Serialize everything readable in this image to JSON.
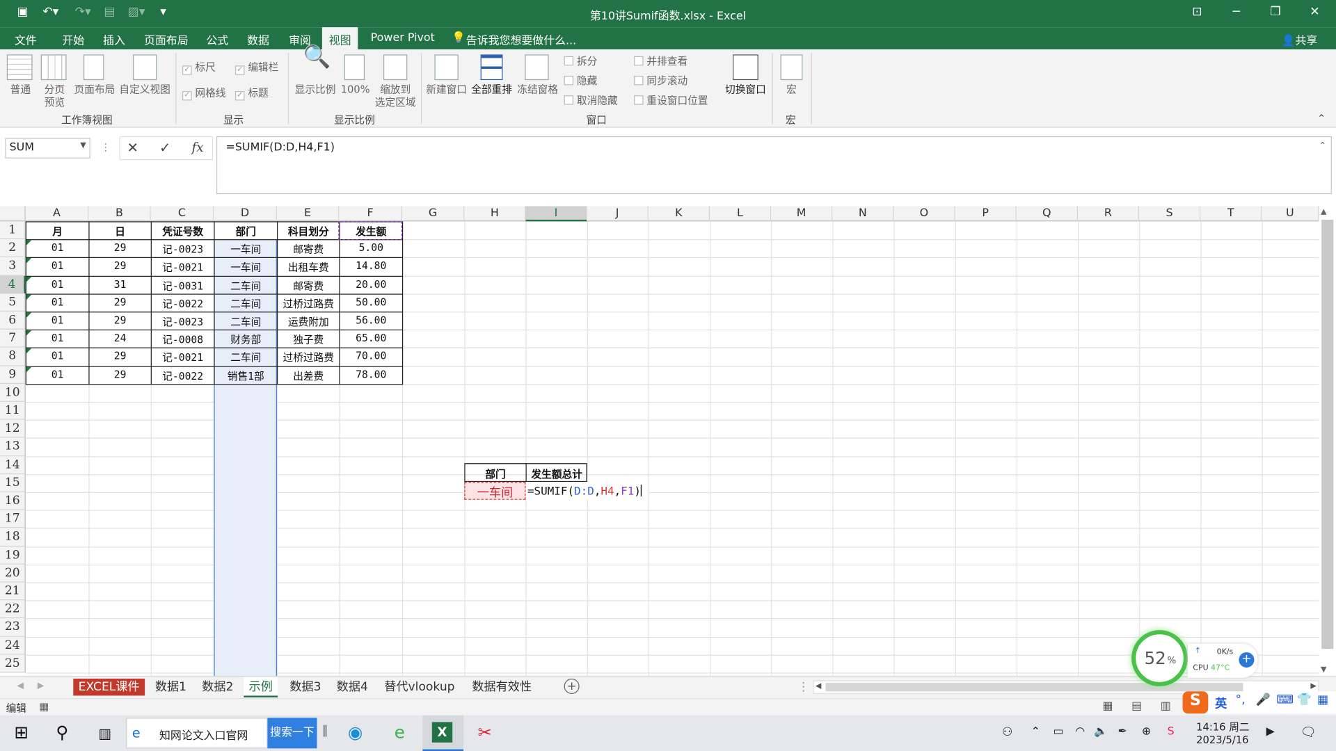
{
  "app": {
    "title": "第10讲Sumif函数.xlsx - Excel"
  },
  "menu": [
    "文件",
    "开始",
    "插入",
    "页面布局",
    "公式",
    "数据",
    "审阅",
    "视图",
    "Power Pivot"
  ],
  "menu_active": "视图",
  "tell_me": "告诉我您想要做什么...",
  "share": "共享",
  "ribbon": {
    "workbook_views": {
      "normal": "普通",
      "page_break_1": "分页",
      "page_break_2": "预览",
      "page_layout": "页面布局",
      "custom": "自定义视图",
      "group": "工作簿视图"
    },
    "show": {
      "ruler": "标尺",
      "formula_bar": "编辑栏",
      "gridlines": "网格线",
      "headings": "标题",
      "group": "显示"
    },
    "zoom": {
      "zoom": "显示比例",
      "hundred": "100%",
      "zoom_sel_1": "缩放到",
      "zoom_sel_2": "选定区域",
      "group": "显示比例"
    },
    "window": {
      "new_window": "新建窗口",
      "arrange_all": "全部重排",
      "freeze": "冻结窗格",
      "split": "拆分",
      "hide": "隐藏",
      "unhide": "取消隐藏",
      "side_by_side": "并排查看",
      "sync_scroll": "同步滚动",
      "reset_pos": "重设窗口位置",
      "switch": "切换窗口",
      "group": "窗口"
    },
    "macros": {
      "macro": "宏",
      "group": "宏"
    }
  },
  "formula_bar": {
    "name_box": "SUM",
    "formula": "=SUMIF(D:D,H4,F1)"
  },
  "columns": [
    "A",
    "B",
    "C",
    "D",
    "E",
    "F",
    "G",
    "H",
    "I",
    "J",
    "K",
    "L",
    "M",
    "N",
    "O",
    "P",
    "Q",
    "R",
    "S",
    "T",
    "U"
  ],
  "rows": [
    "1",
    "2",
    "3",
    "4",
    "5",
    "6",
    "7",
    "8",
    "9",
    "10",
    "11",
    "12",
    "13",
    "14",
    "15",
    "16",
    "17",
    "18",
    "19",
    "20",
    "21",
    "22",
    "23",
    "24",
    "25"
  ],
  "table": {
    "headers": [
      "月",
      "日",
      "凭证号数",
      "部门",
      "科目划分",
      "发生额"
    ],
    "rows": [
      [
        "01",
        "29",
        "记-0023",
        "一车间",
        "邮寄费",
        "5.00"
      ],
      [
        "01",
        "29",
        "记-0021",
        "一车间",
        "出租车费",
        "14.80"
      ],
      [
        "01",
        "31",
        "记-0031",
        "二车间",
        "邮寄费",
        "20.00"
      ],
      [
        "01",
        "29",
        "记-0022",
        "二车间",
        "过桥过路费",
        "50.00"
      ],
      [
        "01",
        "29",
        "记-0023",
        "二车间",
        "运费附加",
        "56.00"
      ],
      [
        "01",
        "24",
        "记-0008",
        "财务部",
        "独子费",
        "65.00"
      ],
      [
        "01",
        "29",
        "记-0021",
        "二车间",
        "过桥过路费",
        "70.00"
      ],
      [
        "01",
        "29",
        "记-0022",
        "销售1部",
        "出差费",
        "78.00"
      ]
    ]
  },
  "summary": {
    "h3": "部门",
    "i3": "发生额总计",
    "h4": "一车间",
    "i4_prefix": "=SUMIF(",
    "i4_a": "D:D",
    "i4_sep1": ",",
    "i4_b": "H4",
    "i4_sep2": ",",
    "i4_c": "F1",
    "i4_suffix": ")"
  },
  "sheet_tabs": [
    "EXCEL课件",
    "数据1",
    "数据2",
    "示例",
    "数据3",
    "数据4",
    "替代vlookup",
    "数据有效性"
  ],
  "active_sheet": "示例",
  "status": {
    "mode": "编辑"
  },
  "monitor": {
    "percent": "52",
    "percent_sign": "%",
    "speed": "0K/s",
    "cpu_label": "CPU",
    "cpu_temp": "47°C"
  },
  "taskbar": {
    "search_text": "知网论文入口官网",
    "search_btn": "搜索一下",
    "time": "14:16 周二",
    "date": "2023/5/16",
    "ime": "英"
  },
  "colors": {
    "excel_green": "#217346",
    "sel_col_fill": "#e8eef9",
    "sel_col_border": "#4a7fd4",
    "f1_border": "#8b3fc7",
    "h4_fill": "#fbe3e3",
    "h4_border": "#d63b3b"
  }
}
